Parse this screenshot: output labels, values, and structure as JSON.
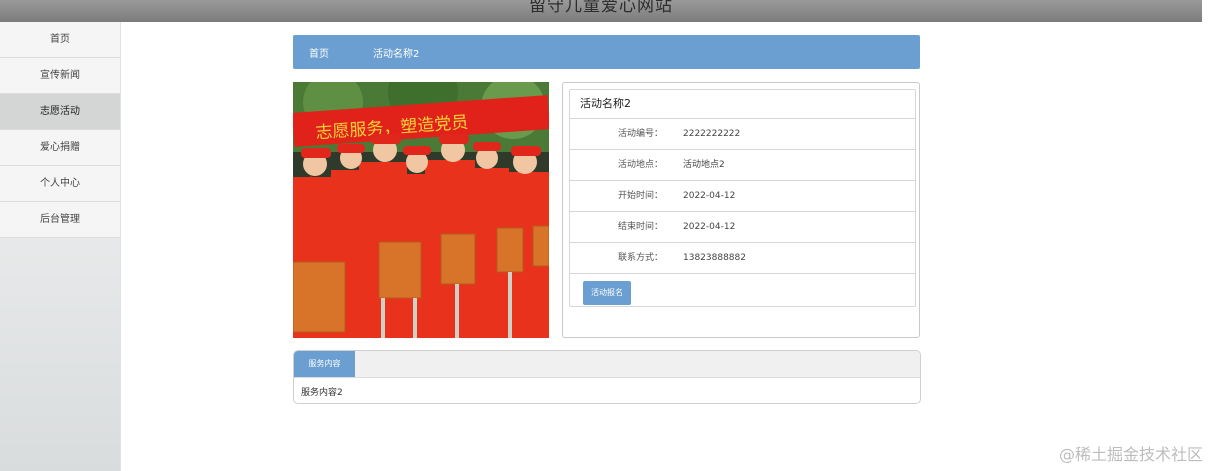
{
  "header": {
    "title": "留守儿童爱心网站"
  },
  "sidebar": {
    "items": [
      {
        "label": "首页",
        "active": false
      },
      {
        "label": "宣传新闻",
        "active": false
      },
      {
        "label": "志愿活动",
        "active": true
      },
      {
        "label": "爱心捐赠",
        "active": false
      },
      {
        "label": "个人中心",
        "active": false
      },
      {
        "label": "后台管理",
        "active": false
      }
    ]
  },
  "breadcrumb": {
    "home": "首页",
    "current": "活动名称2"
  },
  "activity": {
    "title": "活动名称2",
    "rows": [
      {
        "label": "活动编号：",
        "value": "2222222222"
      },
      {
        "label": "活动地点：",
        "value": "活动地点2"
      },
      {
        "label": "开始时间：",
        "value": "2022-04-12"
      },
      {
        "label": "结束时间：",
        "value": "2022-04-12"
      },
      {
        "label": "联系方式：",
        "value": "13823888882"
      }
    ],
    "signup_label": "活动报名"
  },
  "photo": {
    "banner_text": "志愿服务，塑造党员"
  },
  "service": {
    "tab_label": "服务内容",
    "content": "服务内容2"
  },
  "watermark": "@稀土掘金技术社区",
  "colors": {
    "accent": "#6b9fd1",
    "topbar": "#8a8a8a",
    "sidebar_active": "#d4d6d6"
  }
}
